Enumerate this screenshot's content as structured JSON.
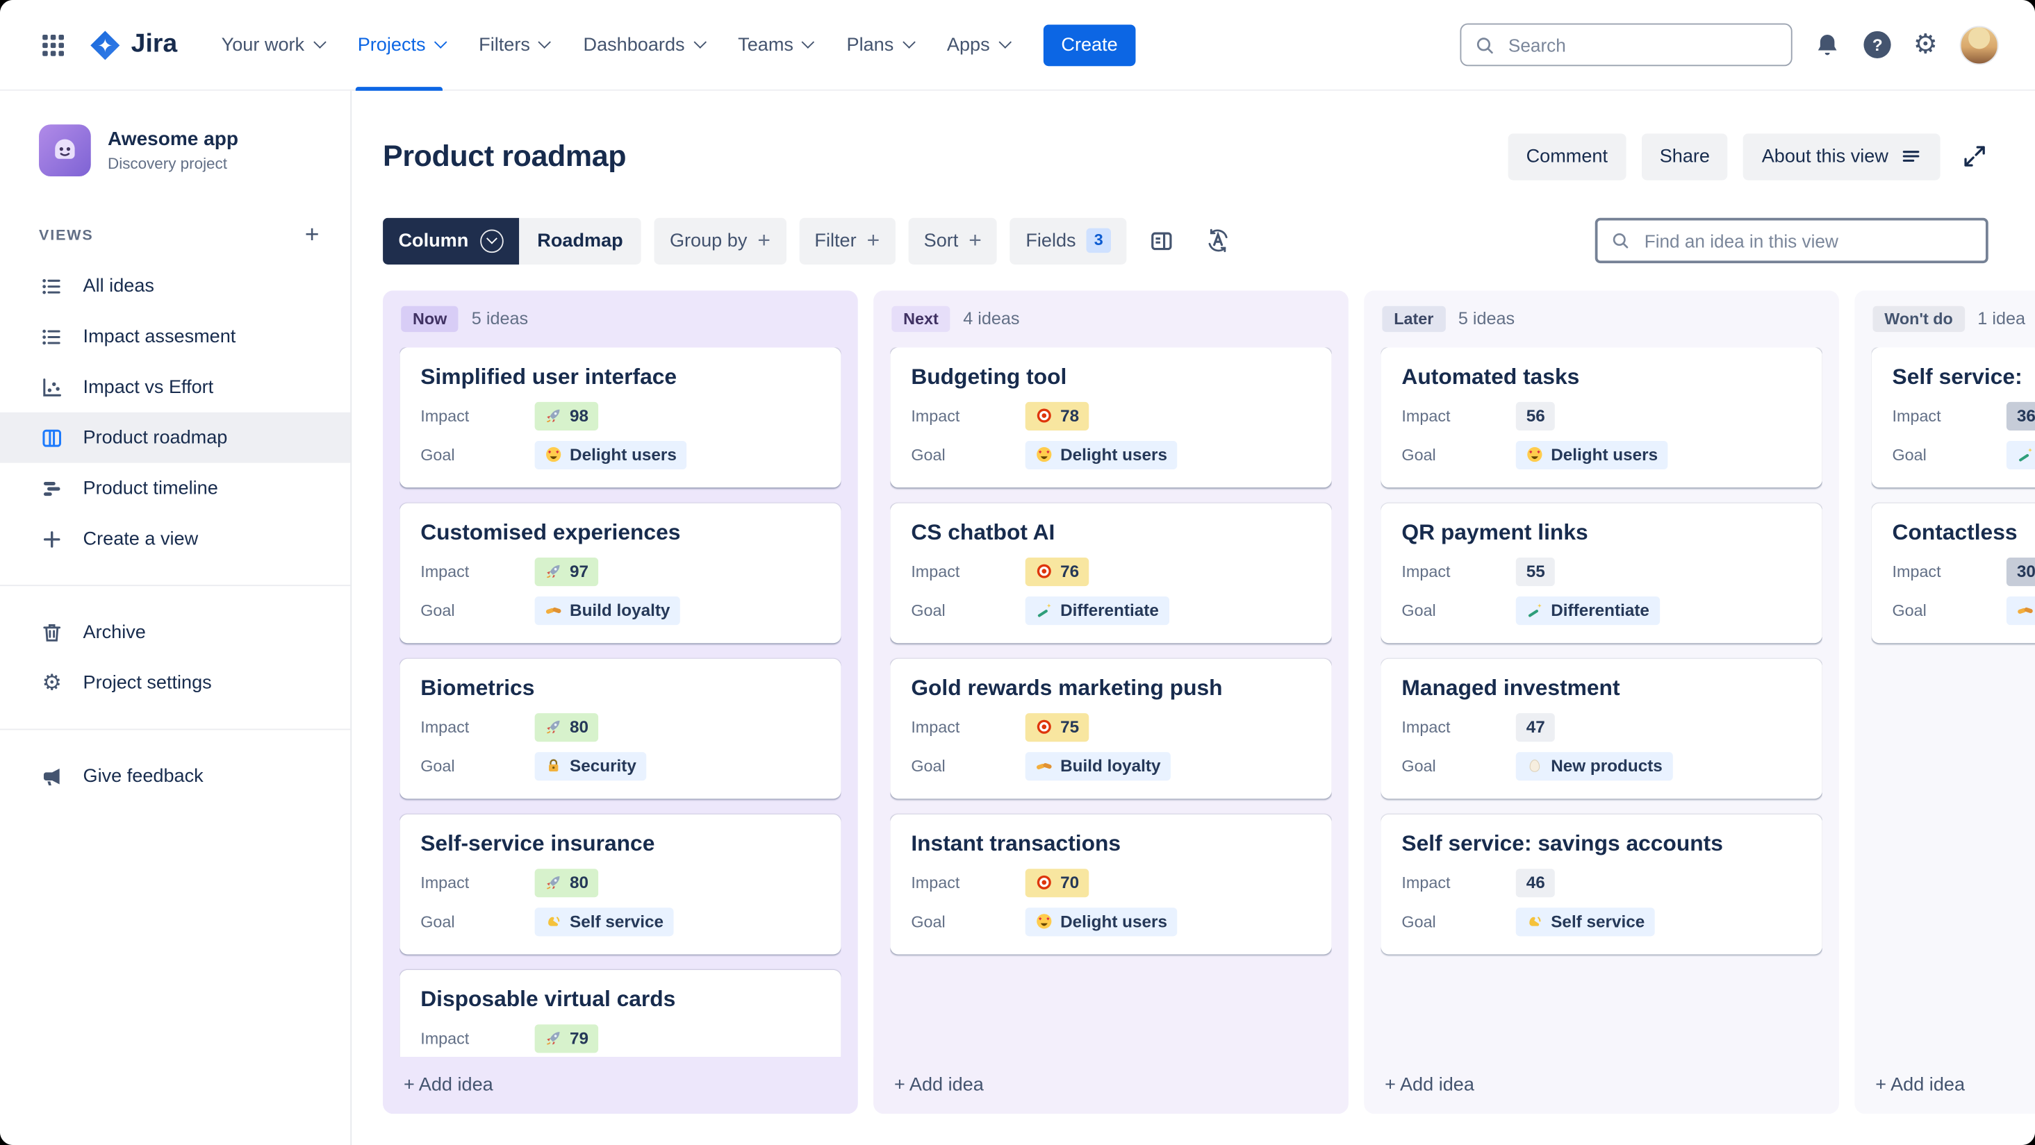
{
  "topnav": {
    "brand": "Jira",
    "items": [
      {
        "label": "Your work",
        "chevron": true,
        "active": false
      },
      {
        "label": "Projects",
        "chevron": true,
        "active": true
      },
      {
        "label": "Filters",
        "chevron": true,
        "active": false
      },
      {
        "label": "Dashboards",
        "chevron": true,
        "active": false
      },
      {
        "label": "Teams",
        "chevron": true,
        "active": false
      },
      {
        "label": "Plans",
        "chevron": true,
        "active": false
      },
      {
        "label": "Apps",
        "chevron": true,
        "active": false
      }
    ],
    "create_label": "Create",
    "search_placeholder": "Search",
    "accent_color": "#0C66E4"
  },
  "sidebar": {
    "project": {
      "name": "Awesome app",
      "type": "Discovery project",
      "avatar_emoji": "👾"
    },
    "views_label": "VIEWS",
    "view_items": [
      {
        "label": "All ideas",
        "icon": "list",
        "selected": false
      },
      {
        "label": "Impact assesment",
        "icon": "list",
        "selected": false
      },
      {
        "label": "Impact vs Effort",
        "icon": "scatter",
        "selected": false
      },
      {
        "label": "Product roadmap",
        "icon": "board",
        "selected": true
      },
      {
        "label": "Product timeline",
        "icon": "timeline",
        "selected": false
      },
      {
        "label": "Create a view",
        "icon": "plus",
        "selected": false
      }
    ],
    "tool_items": [
      {
        "label": "Archive",
        "icon": "trash",
        "selected": false
      },
      {
        "label": "Project settings",
        "icon": "gear",
        "selected": false
      }
    ],
    "footer_items": [
      {
        "label": "Give feedback",
        "icon": "megaphone",
        "selected": false
      }
    ]
  },
  "header": {
    "title": "Product roadmap",
    "buttons": [
      {
        "label": "Comment"
      },
      {
        "label": "Share"
      },
      {
        "label": "About this view",
        "icon": "menu-lines"
      }
    ]
  },
  "toolbar": {
    "view_switcher": {
      "left": "Column",
      "right": "Roadmap"
    },
    "buttons": [
      {
        "label": "Group by",
        "plus": true
      },
      {
        "label": "Filter",
        "plus": true
      },
      {
        "label": "Sort",
        "plus": true
      },
      {
        "label": "Fields",
        "badge": "3"
      }
    ],
    "find_placeholder": "Find an idea in this view"
  },
  "board": {
    "add_label": "+ Add idea",
    "field_labels": {
      "impact": "Impact",
      "goal": "Goal"
    },
    "chip_styles": {
      "green": "#D7F2CC",
      "yellow": "#F8E6A0",
      "grey": "#EDEFF3",
      "dark": "#C6CCD8",
      "blue": "#E9F2FF"
    },
    "themes": {
      "now": {
        "bg": "#EDE7FB",
        "badge_bg": "#D8CDF6",
        "badge_text": "#403163"
      },
      "next": {
        "bg": "#F3EFFB",
        "badge_bg": "#E6DEF9",
        "badge_text": "#403163"
      },
      "later": {
        "bg": "#F7F6FC",
        "badge_bg": "#E2E4F0",
        "badge_text": "#3A4664"
      },
      "wont": {
        "bg": "#F8F8FC",
        "badge_bg": "#E7E8EE",
        "badge_text": "#44546F"
      }
    },
    "columns": [
      {
        "name": "Now",
        "count_label": "5 ideas",
        "theme": "now",
        "cards": [
          {
            "title": "Simplified user interface",
            "impact": {
              "emoji": "🚀",
              "value": "98",
              "style": "green"
            },
            "goal": {
              "emoji": "😍",
              "label": "Delight users"
            }
          },
          {
            "title": "Customised experiences",
            "impact": {
              "emoji": "🚀",
              "value": "97",
              "style": "green"
            },
            "goal": {
              "emoji": "🤝",
              "label": "Build loyalty"
            }
          },
          {
            "title": "Biometrics",
            "impact": {
              "emoji": "🚀",
              "value": "80",
              "style": "green"
            },
            "goal": {
              "emoji": "🔐",
              "label": "Security"
            }
          },
          {
            "title": "Self-service insurance",
            "impact": {
              "emoji": "🚀",
              "value": "80",
              "style": "green"
            },
            "goal": {
              "emoji": "🤙",
              "label": "Self service"
            }
          },
          {
            "title": "Disposable virtual cards",
            "impact": {
              "emoji": "🚀",
              "value": "79",
              "style": "green"
            },
            "goal": null
          }
        ]
      },
      {
        "name": "Next",
        "count_label": "4 ideas",
        "theme": "next",
        "cards": [
          {
            "title": "Budgeting tool",
            "impact": {
              "emoji": "🎯",
              "value": "78",
              "style": "yellow"
            },
            "goal": {
              "emoji": "😍",
              "label": "Delight users"
            }
          },
          {
            "title": "CS chatbot AI",
            "impact": {
              "emoji": "🎯",
              "value": "76",
              "style": "yellow"
            },
            "goal": {
              "emoji": "🪄",
              "label": "Differentiate"
            }
          },
          {
            "title": "Gold rewards marketing push",
            "impact": {
              "emoji": "🎯",
              "value": "75",
              "style": "yellow"
            },
            "goal": {
              "emoji": "🤝",
              "label": "Build loyalty"
            }
          },
          {
            "title": "Instant transactions",
            "impact": {
              "emoji": "🎯",
              "value": "70",
              "style": "yellow"
            },
            "goal": {
              "emoji": "😍",
              "label": "Delight users"
            }
          }
        ]
      },
      {
        "name": "Later",
        "count_label": "5 ideas",
        "theme": "later",
        "cards": [
          {
            "title": "Automated tasks",
            "impact": {
              "value": "56",
              "style": "grey"
            },
            "goal": {
              "emoji": "😍",
              "label": "Delight users"
            }
          },
          {
            "title": "QR payment links",
            "impact": {
              "value": "55",
              "style": "grey"
            },
            "goal": {
              "emoji": "🪄",
              "label": "Differentiate"
            }
          },
          {
            "title": "Managed investment",
            "impact": {
              "value": "47",
              "style": "grey"
            },
            "goal": {
              "emoji": "🥚",
              "label": "New products"
            }
          },
          {
            "title": "Self service: savings accounts",
            "impact": {
              "value": "46",
              "style": "grey"
            },
            "goal": {
              "emoji": "🤙",
              "label": "Self service"
            }
          }
        ]
      },
      {
        "name": "Won't do",
        "count_label": "1 idea",
        "theme": "wont",
        "cards": [
          {
            "title": "Self service:",
            "impact": {
              "value": "36",
              "style": "dark"
            },
            "goal": {
              "emoji": "🪄",
              "label": ""
            }
          },
          {
            "title": "Contactless",
            "impact": {
              "value": "30",
              "style": "dark"
            },
            "goal": {
              "emoji": "🤝",
              "label": ""
            }
          }
        ]
      }
    ]
  }
}
